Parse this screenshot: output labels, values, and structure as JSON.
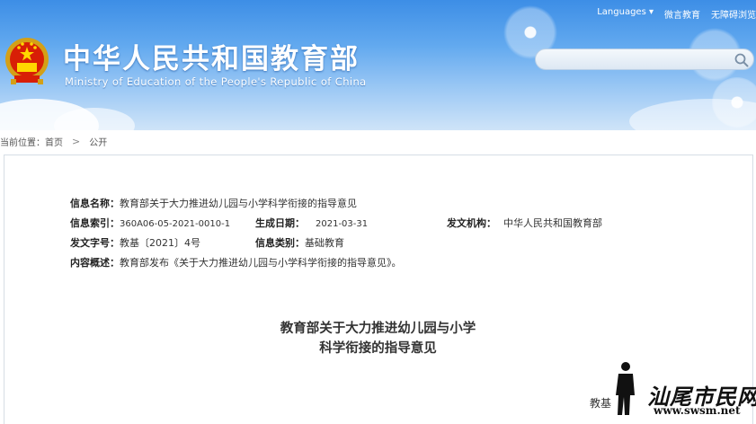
{
  "header": {
    "top_links": [
      "Languages",
      "微言教育",
      "无障碍浏览"
    ],
    "languages_caret": "▾",
    "title": "中华人民共和国教育部",
    "subtitle": "Ministry of Education of the People's Republic of China",
    "search": {
      "value": "",
      "placeholder": ""
    }
  },
  "breadcrumb": {
    "prefix": "当前位置：",
    "items": [
      "首页",
      "公开"
    ],
    "separator": ">"
  },
  "meta": {
    "name_label": "信息名称：",
    "name_value": "教育部关于大力推进幼儿园与小学科学衔接的指导意见",
    "index_label": "信息索引：",
    "index_value": "360A06-05-2021-0010-1",
    "date_label": "生成日期：",
    "date_value": "2021-03-31",
    "agency_label": "发文机构：",
    "agency_value": "中华人民共和国教育部",
    "docno_label": "发文字号：",
    "docno_value": "教基〔2021〕4号",
    "category_label": "信息类别：",
    "category_value": "基础教育",
    "summary_label": "内容概述：",
    "summary_value": "教育部发布《关于大力推进幼儿园与小学科学衔接的指导意见》。"
  },
  "document": {
    "title_line1": "教育部关于大力推进幼儿园与小学",
    "title_line2": "科学衔接的指导意见",
    "body_start": "教基"
  },
  "watermark": {
    "text": "汕尾市民网",
    "url": "www.swsm.net"
  },
  "colors": {
    "header_top": "#3d8ee6",
    "header_bottom": "#cfe4f8",
    "text": "#333333"
  }
}
